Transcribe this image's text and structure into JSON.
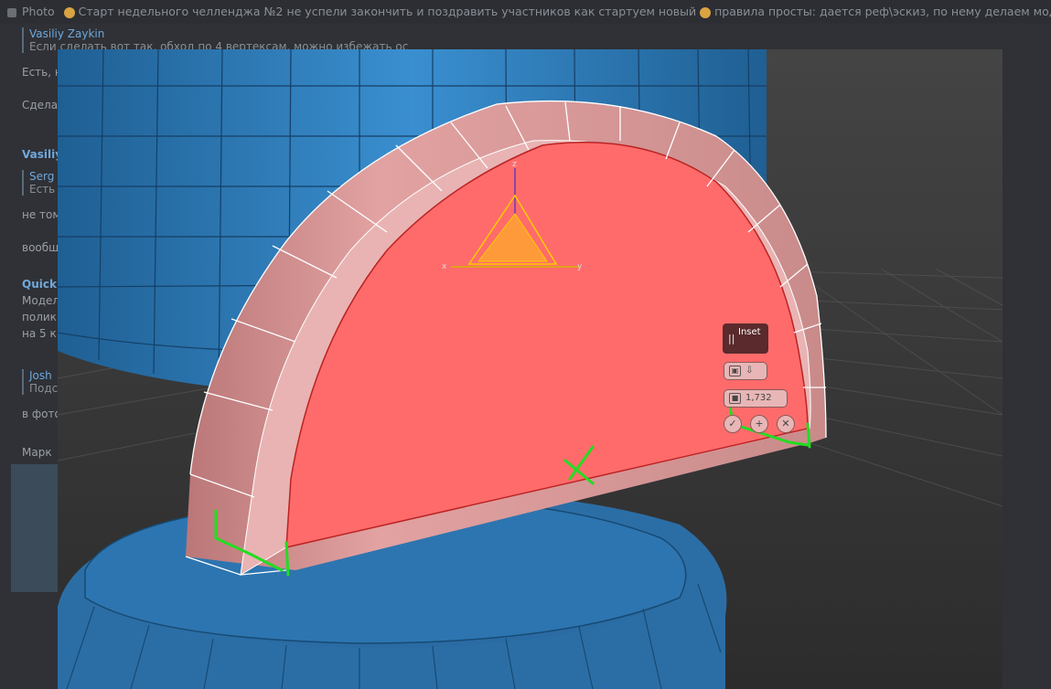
{
  "chat": {
    "pinned": {
      "label": "Photo",
      "text": "Старт недельного челленджа №2  не успели закончить и поздравить участников как стартуем новый",
      "text2": "правила просты: дается реф\\эскиз, по нему делаем модельки, со"
    },
    "messages": {
      "reply1_name": "Vasiliy Zaykin",
      "reply1_text": "Если сделать вот так, обход по 4 вертексам, можно избежать ос",
      "m1": "Есть, н",
      "m2": "Сдела",
      "author2": "Vasiliy",
      "reply2_name": "Serg",
      "reply2_text": "Есть",
      "m3": "не том",
      "m4": "вообщ",
      "author3": "Quick",
      "m5": "Модел",
      "m6": "полик",
      "m7": "на 5 к",
      "reply3_name": "Josh",
      "reply3_text": "Подс",
      "m8": "в фото",
      "m9": "Марк"
    }
  },
  "viewport": {
    "gizmo_axes": {
      "x": "x",
      "y": "y",
      "z": "z"
    },
    "inset_tool": {
      "title": "Inset",
      "value": "1,732"
    },
    "colors": {
      "background": "#3a3a3a",
      "blue_mesh": "#2e7fbf",
      "selected_face": "#ff6b6b",
      "mesh_body": "#d99696",
      "annotation": "#22dd22"
    }
  }
}
